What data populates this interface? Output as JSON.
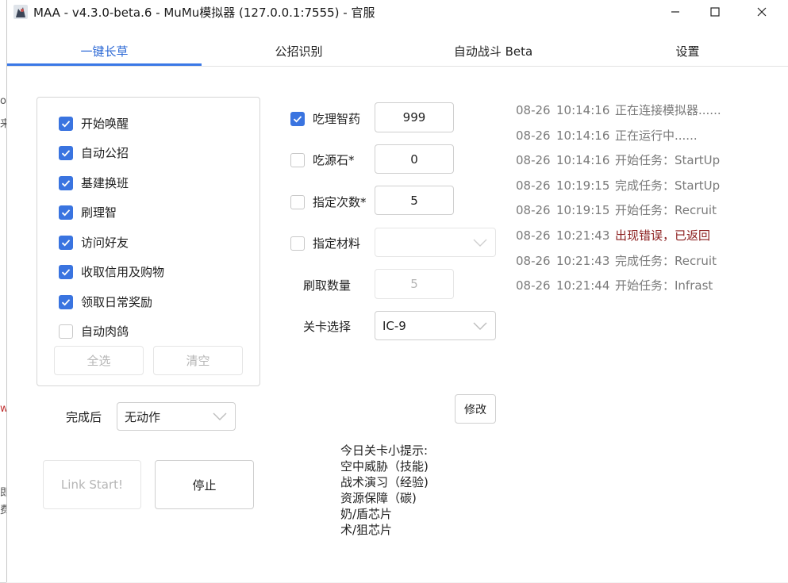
{
  "window": {
    "title": "MAA - v4.3.0-beta.6 - MuMu模拟器 (127.0.0.1:7555) - 官服",
    "controls": {
      "minimize": "minimize-icon",
      "maximize": "maximize-icon",
      "close": "close-icon"
    }
  },
  "tabs": [
    {
      "label": "一键长草",
      "active": true
    },
    {
      "label": "公招识别",
      "active": false
    },
    {
      "label": "自动战斗 Beta",
      "active": false
    },
    {
      "label": "设置",
      "active": false
    }
  ],
  "tasks": [
    {
      "label": "开始唤醒",
      "checked": true
    },
    {
      "label": "自动公招",
      "checked": true
    },
    {
      "label": "基建换班",
      "checked": true
    },
    {
      "label": "刷理智",
      "checked": true
    },
    {
      "label": "访问好友",
      "checked": true
    },
    {
      "label": "收取信用及购物",
      "checked": true
    },
    {
      "label": "领取日常奖励",
      "checked": true
    },
    {
      "label": "自动肉鸽",
      "checked": false
    }
  ],
  "task_buttons": {
    "select_all": "全选",
    "clear": "清空"
  },
  "after_complete": {
    "label": "完成后",
    "value": "无动作"
  },
  "actions": {
    "start": "Link Start!",
    "stop": "停止"
  },
  "fight": {
    "medicine": {
      "label": "吃理智药",
      "checked": true,
      "value": "999"
    },
    "stone": {
      "label": "吃源石*",
      "checked": false,
      "value": "0"
    },
    "times": {
      "label": "指定次数*",
      "checked": false,
      "value": "5"
    },
    "material": {
      "label": "指定材料",
      "checked": false,
      "value": ""
    },
    "drop_count": {
      "label": "刷取数量",
      "value": "5"
    },
    "stage": {
      "label": "关卡选择",
      "value": "IC-9"
    },
    "modify_button": "修改"
  },
  "tips": {
    "title": "今日关卡小提示:",
    "lines": [
      "空中威胁（技能)",
      "战术演习（经验)",
      "资源保障（碳)",
      "奶/盾芯片",
      "术/狙芯片"
    ]
  },
  "log": [
    {
      "date": "08-26",
      "time": "10:14:16",
      "msg": "正在连接模拟器......",
      "error": false
    },
    {
      "date": "08-26",
      "time": "10:14:16",
      "msg": "正在运行中......",
      "error": false
    },
    {
      "date": "08-26",
      "time": "10:14:16",
      "msg": "开始任务：StartUp",
      "error": false
    },
    {
      "date": "08-26",
      "time": "10:19:15",
      "msg": "完成任务：StartUp",
      "error": false
    },
    {
      "date": "08-26",
      "time": "10:19:15",
      "msg": "开始任务：Recruit",
      "error": false
    },
    {
      "date": "08-26",
      "time": "10:21:43",
      "msg": "出现错误，已返回",
      "error": true
    },
    {
      "date": "08-26",
      "time": "10:21:43",
      "msg": "完成任务：Recruit",
      "error": false
    },
    {
      "date": "08-26",
      "time": "10:21:44",
      "msg": "开始任务：Infrast",
      "error": false
    }
  ],
  "colors": {
    "accent": "#3a74e0",
    "error": "#8b1d1d",
    "log_text": "#7a7a7a"
  }
}
